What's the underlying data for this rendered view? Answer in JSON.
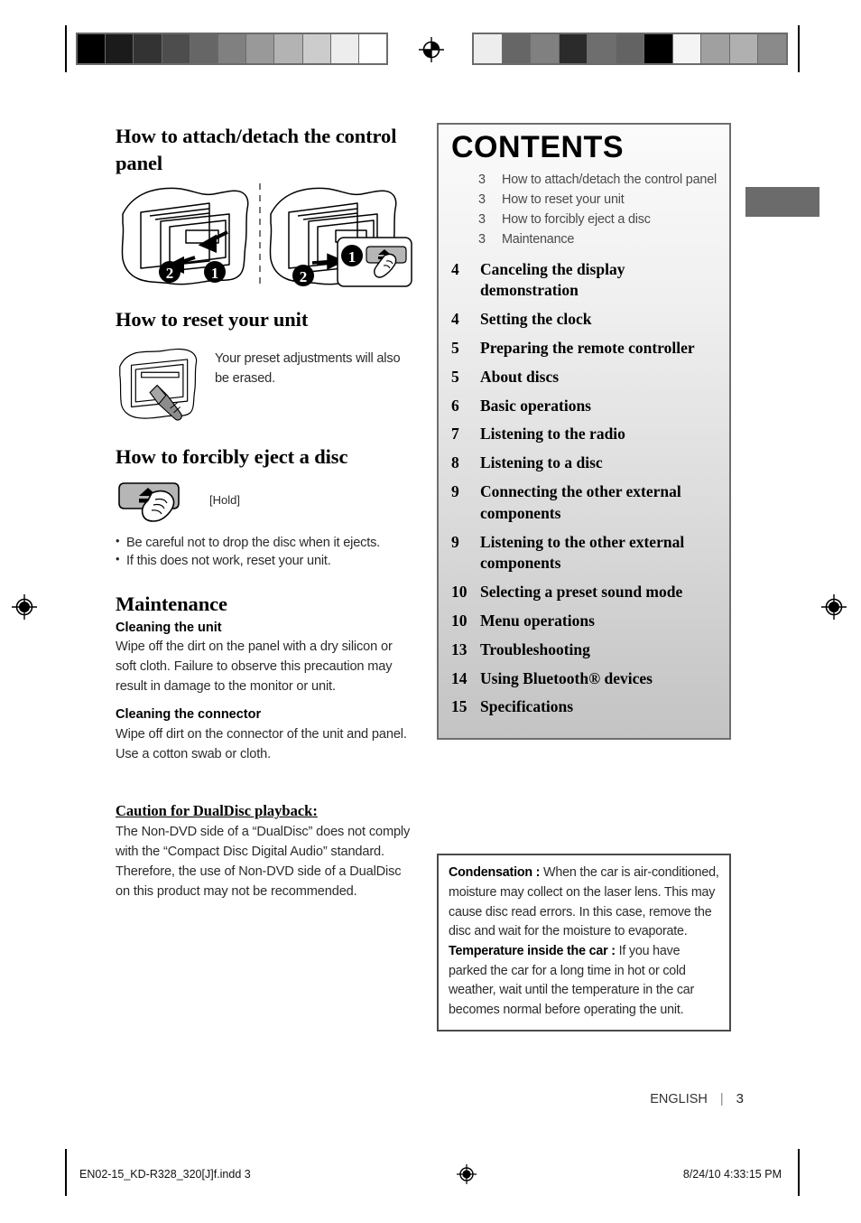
{
  "document": {
    "language_footer": "ENGLISH",
    "footer_divider": "|",
    "page_number": "3",
    "print_filename": "EN02-15_KD-R328_320[J]f.indd   3",
    "print_date": "8/24/10   4:33:15 PM"
  },
  "left_column": {
    "attach_section": {
      "title": "How to attach/detach the control panel",
      "step_labels": [
        "1",
        "2",
        "1",
        "2"
      ]
    },
    "reset_section": {
      "title": "How to reset your unit",
      "note": "Your preset adjustments will also be erased."
    },
    "eject_section": {
      "title": "How to forcibly eject a disc",
      "hold_label": "[Hold]",
      "bullets": [
        "Be careful not to drop the disc when it ejects.",
        "If this does not work, reset your unit."
      ]
    },
    "maintenance_section": {
      "title": "Maintenance",
      "cleaning_unit_heading": "Cleaning the unit",
      "cleaning_unit_body": "Wipe off the dirt on the panel with a dry silicon or soft cloth. Failure to observe this precaution may result in damage to the monitor or unit.",
      "cleaning_connector_heading": "Cleaning the connector",
      "cleaning_connector_body": "Wipe off dirt on the connector of the unit and panel. Use a cotton swab or cloth."
    },
    "caution_section": {
      "title": "Caution for DualDisc playback:",
      "body": "The Non-DVD side of a “DualDisc” does not comply with the “Compact Disc Digital Audio” standard. Therefore, the use of Non-DVD side of a DualDisc on this product may not be recommended."
    }
  },
  "right_column": {
    "contents": {
      "heading": "CONTENTS",
      "sub_entries": [
        {
          "page": "3",
          "title": "How to attach/detach the control panel"
        },
        {
          "page": "3",
          "title": "How to reset your unit"
        },
        {
          "page": "3",
          "title": "How to forcibly eject a disc"
        },
        {
          "page": "3",
          "title": "Maintenance"
        }
      ],
      "main_entries": [
        {
          "page": "4",
          "title": "Canceling the display demonstration"
        },
        {
          "page": "4",
          "title": "Setting the clock"
        },
        {
          "page": "5",
          "title": "Preparing the remote controller"
        },
        {
          "page": "5",
          "title": "About discs"
        },
        {
          "page": "6",
          "title": "Basic operations"
        },
        {
          "page": "7",
          "title": "Listening to the radio"
        },
        {
          "page": "8",
          "title": "Listening to a disc"
        },
        {
          "page": "9",
          "title": "Connecting the other external components"
        },
        {
          "page": "9",
          "title": "Listening to the other external components"
        },
        {
          "page": "10",
          "title": "Selecting a preset sound mode"
        },
        {
          "page": "10",
          "title": "Menu operations"
        },
        {
          "page": "13",
          "title": "Troubleshooting"
        },
        {
          "page": "14",
          "title": "Using Bluetooth® devices"
        },
        {
          "page": "15",
          "title": "Specifications"
        }
      ]
    },
    "note_box": {
      "condensation_label": "Condensation :",
      "condensation_body": " When the car is air-conditioned, moisture may collect on the laser lens. This may cause disc read errors. In this case, remove the disc and wait for the moisture to evaporate.",
      "temperature_label": "Temperature inside the car :",
      "temperature_body": " If you have parked the car for a long time in hot or cold weather, wait until the temperature in the car becomes normal before operating the unit."
    }
  },
  "print_marks": {
    "left_step_bar": [
      "#000000",
      "#1b1b1b",
      "#333333",
      "#4d4d4d",
      "#666666",
      "#808080",
      "#999999",
      "#b3b3b3",
      "#cccccc",
      "#ededed",
      "#ffffff"
    ],
    "right_step_bar": [
      "#ededed",
      "#666666",
      "#808080",
      "#2b2b2b",
      "#6e6e6e",
      "#636363",
      "#000000",
      "#f4f4f4",
      "#a0a0a0",
      "#b0b0b0",
      "#8a8a8a"
    ],
    "edge_tab_color": "#6b6b6b"
  }
}
